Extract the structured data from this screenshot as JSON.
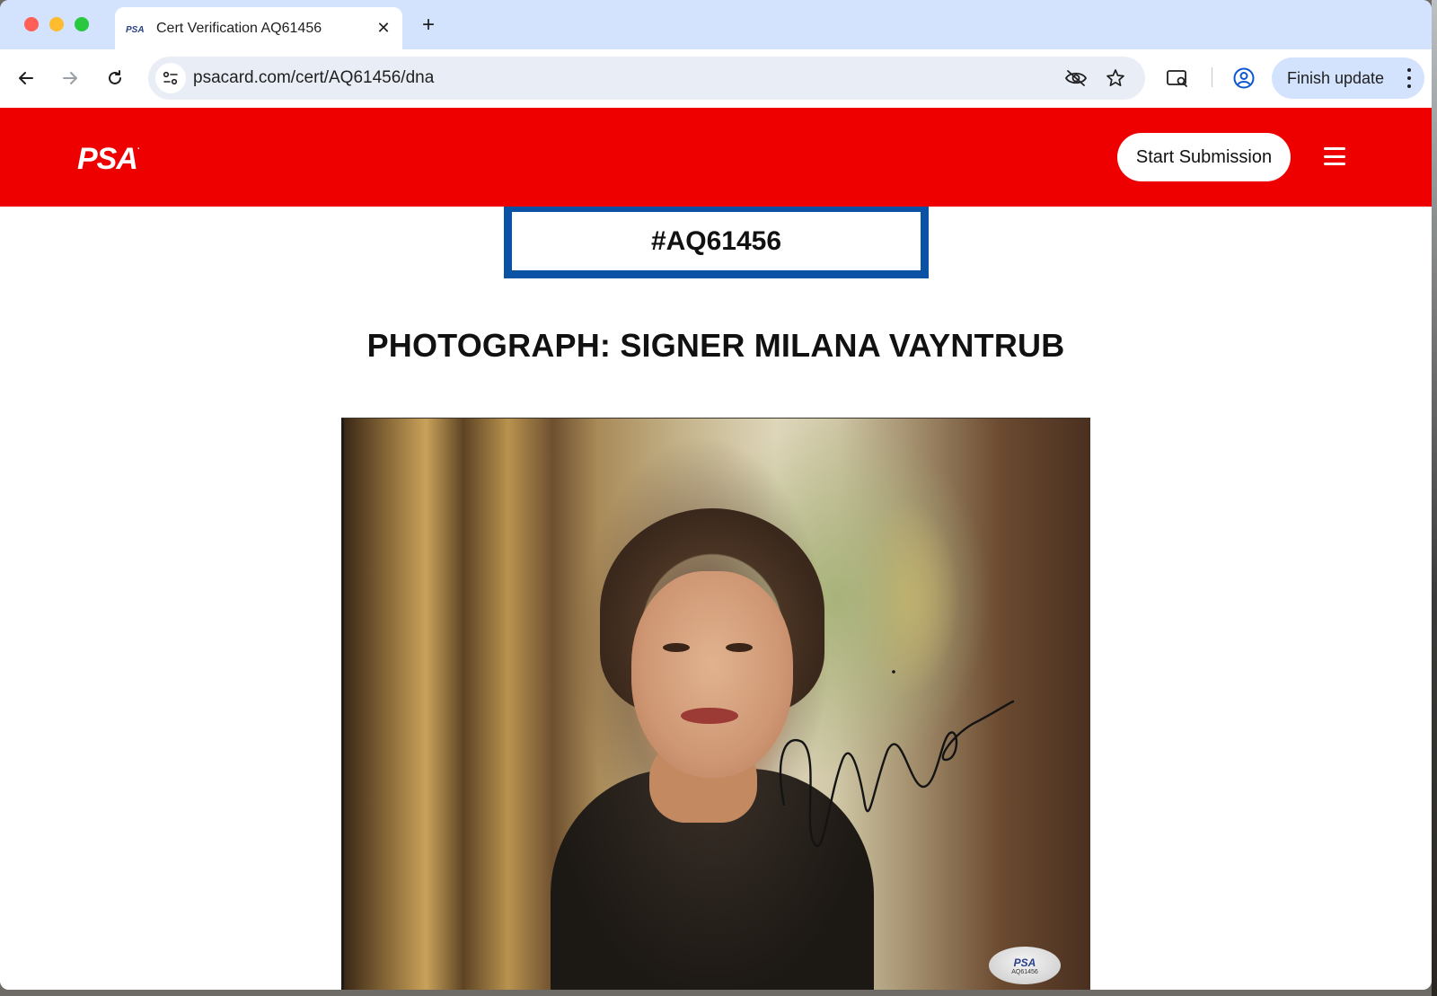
{
  "browser": {
    "tab_title": "Cert Verification AQ61456",
    "favicon_text": "PSA",
    "url": "psacard.com/cert/AQ61456/dna",
    "finish_update_label": "Finish update",
    "new_tab_symbol": "+",
    "close_tab_symbol": "✕"
  },
  "site": {
    "logo_text": "PSA",
    "start_submission_label": "Start Submission",
    "header_color": "#ee0000"
  },
  "cert": {
    "number": "#AQ61456",
    "title": "PHOTOGRAPH: SIGNER MILANA VAYNTRUB"
  },
  "photo": {
    "sticker_logo": "PSA",
    "sticker_number": "AQ61456"
  }
}
